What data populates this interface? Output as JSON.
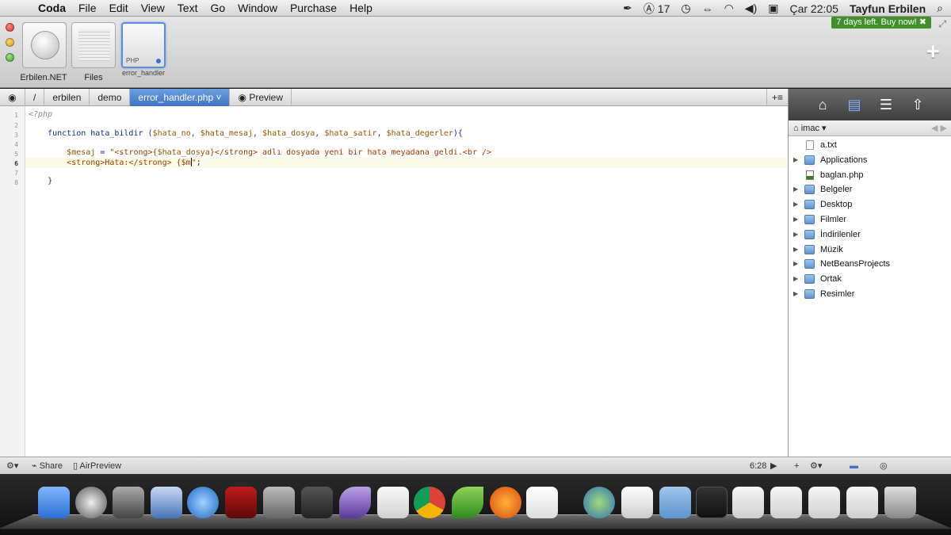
{
  "menubar": {
    "app_name": "Coda",
    "menus": [
      "File",
      "Edit",
      "View",
      "Text",
      "Go",
      "Window",
      "Purchase",
      "Help"
    ],
    "status_number": "17",
    "clock": "Çar 22:05",
    "user": "Tayfun Erbilen"
  },
  "toolbar": {
    "sites": [
      {
        "label": "Erbilen.NET"
      },
      {
        "label": "Files"
      },
      {
        "label": "error_handler",
        "tag": "PHP"
      }
    ],
    "trial_badge": "7 days left. Buy now! ✖"
  },
  "pathbar": {
    "root": "/",
    "crumbs": [
      "erbilen",
      "demo"
    ],
    "active_file": "error_handler.php ˅",
    "preview_label": "Preview",
    "tools_label": "+≡"
  },
  "editor": {
    "line_numbers": [
      "1",
      "2",
      "3",
      "4",
      "5",
      "6",
      "7",
      "8"
    ],
    "current_line": 6
  },
  "sidebar": {
    "location": "imac",
    "items": [
      {
        "name": "a.txt",
        "type": "doc"
      },
      {
        "name": "Applications",
        "type": "folder"
      },
      {
        "name": "baglan.php",
        "type": "php"
      },
      {
        "name": "Belgeler",
        "type": "folder"
      },
      {
        "name": "Desktop",
        "type": "folder"
      },
      {
        "name": "Filmler",
        "type": "folder"
      },
      {
        "name": "İndirilenler",
        "type": "folder"
      },
      {
        "name": "Müzik",
        "type": "folder"
      },
      {
        "name": "NetBeansProjects",
        "type": "folder"
      },
      {
        "name": "Ortak",
        "type": "folder"
      },
      {
        "name": "Resimler",
        "type": "folder"
      }
    ]
  },
  "statusbar": {
    "share_label": "Share",
    "airpreview_label": "AirPreview",
    "cursor_position": "6:28"
  },
  "colors": {
    "accent": "#3f74c4",
    "trial_badge": "#3f8f2a",
    "dock_bg": "#1a1a1a"
  }
}
